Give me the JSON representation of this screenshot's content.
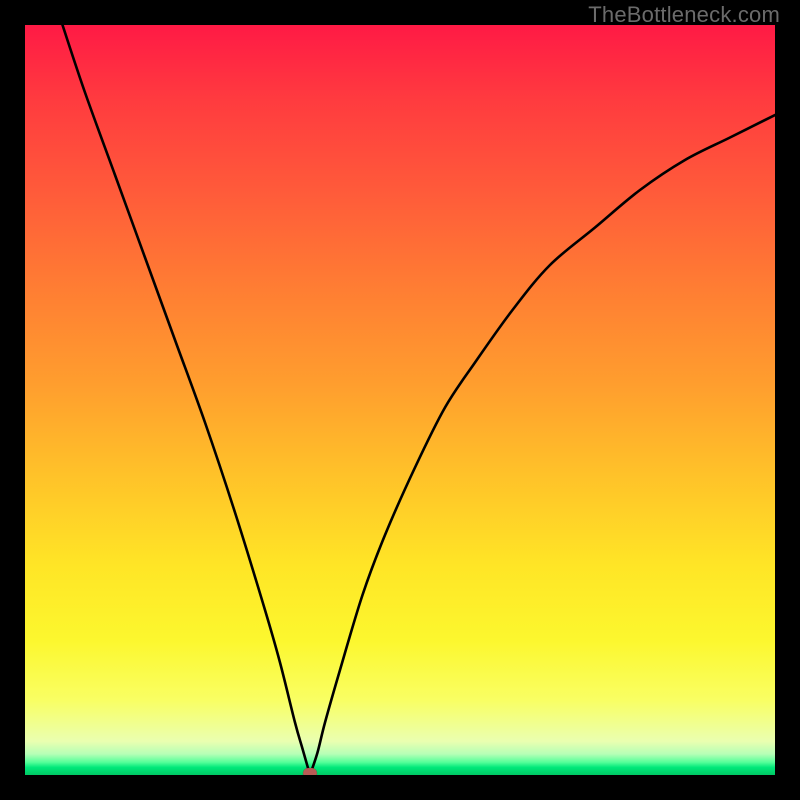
{
  "watermark": "TheBottleneck.com",
  "marker_color": "#b85a55",
  "gradient_stops": [
    {
      "pos": 0.0,
      "color": "#ff1a45"
    },
    {
      "pos": 0.1,
      "color": "#ff3b3f"
    },
    {
      "pos": 0.22,
      "color": "#ff5a3a"
    },
    {
      "pos": 0.35,
      "color": "#ff7d33"
    },
    {
      "pos": 0.48,
      "color": "#ff9e2e"
    },
    {
      "pos": 0.6,
      "color": "#ffc229"
    },
    {
      "pos": 0.72,
      "color": "#ffe526"
    },
    {
      "pos": 0.82,
      "color": "#fcf72e"
    },
    {
      "pos": 0.9,
      "color": "#f9ff63"
    },
    {
      "pos": 0.955,
      "color": "#eaffb0"
    },
    {
      "pos": 0.972,
      "color": "#b6ffb6"
    },
    {
      "pos": 0.983,
      "color": "#55ff99"
    },
    {
      "pos": 0.99,
      "color": "#00e87a"
    },
    {
      "pos": 1.0,
      "color": "#00c964"
    }
  ],
  "chart_data": {
    "type": "line",
    "title": "",
    "xlabel": "",
    "ylabel": "",
    "xlim": [
      0,
      100
    ],
    "ylim": [
      0,
      100
    ],
    "marker": {
      "x": 38,
      "y": 0
    },
    "series": [
      {
        "name": "left-branch",
        "x": [
          5,
          8,
          12,
          16,
          20,
          24,
          28,
          32,
          34,
          36,
          37,
          38
        ],
        "y": [
          100,
          91,
          80,
          69,
          58,
          47,
          35,
          22,
          15,
          7,
          3.5,
          0
        ]
      },
      {
        "name": "right-branch",
        "x": [
          38,
          39,
          40,
          42,
          45,
          48,
          52,
          56,
          60,
          65,
          70,
          76,
          82,
          88,
          94,
          100
        ],
        "y": [
          0,
          3,
          7,
          14,
          24,
          32,
          41,
          49,
          55,
          62,
          68,
          73,
          78,
          82,
          85,
          88
        ]
      }
    ]
  }
}
